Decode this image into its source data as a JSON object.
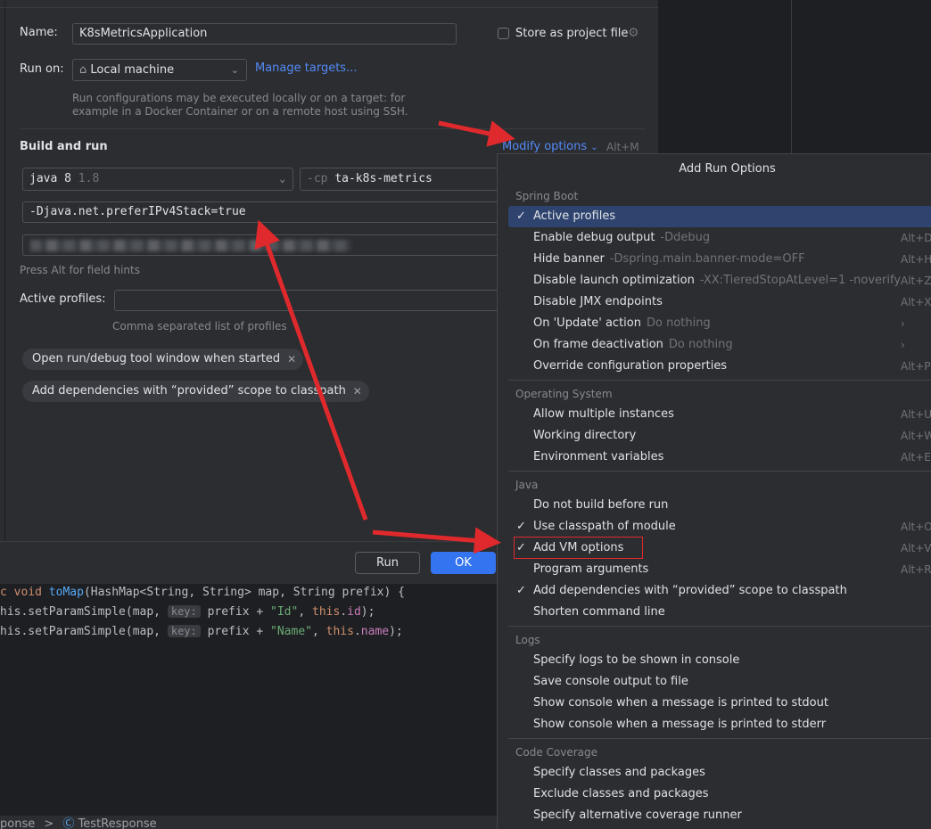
{
  "form": {
    "name_label": "Name:",
    "name_value": "K8sMetricsApplication",
    "store_label": "Store as project file",
    "store_checked": false,
    "runon_label": "Run on:",
    "runon_value": "Local machine",
    "manage_targets": "Manage targets...",
    "runon_hint_1": "Run configurations may be executed locally or on a target: for",
    "runon_hint_2": "example in a Docker Container or on a remote host using SSH.",
    "build_run_title": "Build and run",
    "modify_options": "Modify options",
    "modify_shortcut": "Alt+M",
    "jdk_name": "java 8",
    "jdk_version": "1.8",
    "cp_flag": "-cp",
    "cp_value": "ta-k8s-metrics",
    "vm_options": "-Djava.net.preferIPv4Stack=true",
    "field_hint": "Press Alt for field hints",
    "profiles_label": "Active profiles:",
    "profiles_hint": "Comma separated list of profiles",
    "chips": [
      "Open run/debug tool window when started",
      "Add dependencies with “provided” scope to classpath"
    ],
    "run_button": "Run",
    "ok_button": "OK"
  },
  "editor": {
    "line1": {
      "prefix": "c ",
      "kw1": "void",
      "fn": "toMap",
      "rest": "(HashMap<String, String> map, String prefix) {"
    },
    "line2": {
      "start": "his.setParamSimple(map, ",
      "hint": "key:",
      "mid": " prefix + ",
      "str": "\"Id\"",
      "comma": ", ",
      "this": "this",
      "dot": ".",
      "field": "id",
      "end": ");"
    },
    "line3": {
      "start": "his.setParamSimple(map, ",
      "hint": "key:",
      "mid": " prefix + ",
      "str": "\"Name\"",
      "comma": ", ",
      "this": "this",
      "dot": ".",
      "field": "name",
      "end": ");"
    },
    "status_left": "ponse",
    "status_sep": ">",
    "status_right": "TestResponse"
  },
  "popup": {
    "title": "Add Run Options",
    "groups": {
      "spring_boot": "Spring Boot",
      "os": "Operating System",
      "java": "Java",
      "logs": "Logs",
      "coverage": "Code Coverage"
    },
    "items": [
      {
        "label": "Active profiles",
        "hint": "",
        "shortcut": "",
        "checked": true
      },
      {
        "label": "Enable debug output",
        "hint": "-Ddebug",
        "shortcut": "Alt+D",
        "checked": false
      },
      {
        "label": "Hide banner",
        "hint": "-Dspring.main.banner-mode=OFF",
        "shortcut": "Alt+H",
        "checked": false
      },
      {
        "label": "Disable launch optimization",
        "hint": "-XX:TieredStopAtLevel=1 -noverify",
        "shortcut": "Alt+Z",
        "checked": false
      },
      {
        "label": "Disable JMX endpoints",
        "hint": "",
        "shortcut": "Alt+X",
        "checked": false
      },
      {
        "label": "On 'Update' action",
        "hint": "Do nothing",
        "shortcut": "›",
        "checked": false
      },
      {
        "label": "On frame deactivation",
        "hint": "Do nothing",
        "shortcut": "›",
        "checked": false
      },
      {
        "label": "Override configuration properties",
        "hint": "",
        "shortcut": "Alt+P",
        "checked": false
      },
      {
        "label": "Allow multiple instances",
        "hint": "",
        "shortcut": "Alt+U",
        "checked": false
      },
      {
        "label": "Working directory",
        "hint": "",
        "shortcut": "Alt+W",
        "checked": false
      },
      {
        "label": "Environment variables",
        "hint": "",
        "shortcut": "Alt+E",
        "checked": false
      },
      {
        "label": "Do not build before run",
        "hint": "",
        "shortcut": "",
        "checked": false
      },
      {
        "label": "Use classpath of module",
        "hint": "",
        "shortcut": "Alt+O",
        "checked": true
      },
      {
        "label": "Add VM options",
        "hint": "",
        "shortcut": "Alt+V",
        "checked": true
      },
      {
        "label": "Program arguments",
        "hint": "",
        "shortcut": "Alt+R",
        "checked": false
      },
      {
        "label": "Add dependencies with “provided” scope to classpath",
        "hint": "",
        "shortcut": "",
        "checked": true
      },
      {
        "label": "Shorten command line",
        "hint": "",
        "shortcut": "",
        "checked": false
      },
      {
        "label": "Specify logs to be shown in console",
        "hint": "",
        "shortcut": "",
        "checked": false
      },
      {
        "label": "Save console output to file",
        "hint": "",
        "shortcut": "",
        "checked": false
      },
      {
        "label": "Show console when a message is printed to stdout",
        "hint": "",
        "shortcut": "",
        "checked": false
      },
      {
        "label": "Show console when a message is printed to stderr",
        "hint": "",
        "shortcut": "",
        "checked": false
      },
      {
        "label": "Specify classes and packages",
        "hint": "",
        "shortcut": "",
        "checked": false
      },
      {
        "label": "Exclude classes and packages",
        "hint": "",
        "shortcut": "",
        "checked": false
      },
      {
        "label": "Specify alternative coverage runner",
        "hint": "",
        "shortcut": "",
        "checked": false
      }
    ]
  },
  "colors": {
    "accent": "#3574f0",
    "link": "#548af7",
    "selection": "#2e436e",
    "annotation_red": "#e0292c"
  }
}
